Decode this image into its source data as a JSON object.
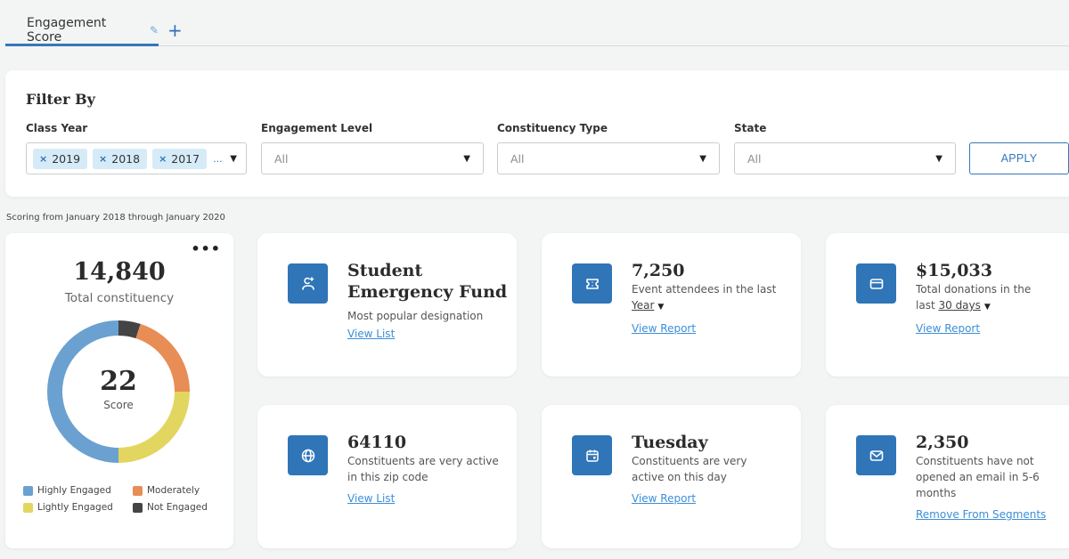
{
  "tabs": {
    "active_label": "Engagement Score",
    "edit_icon": "pencil-icon",
    "add_icon": "plus-icon",
    "add_label": "+"
  },
  "filter": {
    "title": "Filter By",
    "class_year": {
      "label": "Class Year",
      "chips": [
        "2019",
        "2018",
        "2017"
      ],
      "overflow": "...",
      "remove_glyph": "×"
    },
    "engagement_level": {
      "label": "Engagement Level",
      "value": "All"
    },
    "constituency_type": {
      "label": "Constituency Type",
      "value": "All"
    },
    "state": {
      "label": "State",
      "value": "All"
    },
    "apply_label": "APPLY",
    "caret": "▼"
  },
  "scoring_range": "Scoring from January 2018 through January 2020",
  "score_card": {
    "menu_glyph": "•••",
    "total": "14,840",
    "total_label": "Total constituency",
    "score": "22",
    "score_label": "Score",
    "legend": [
      {
        "label": "Highly Engaged",
        "color": "#6aa1d0"
      },
      {
        "label": "Moderately",
        "color": "#e88d55"
      },
      {
        "label": "Lightly Engaged",
        "color": "#e2d660"
      },
      {
        "label": "Not Engaged",
        "color": "#444444"
      }
    ]
  },
  "chart_data": {
    "type": "pie",
    "variant": "donut",
    "title": "Total constituency",
    "center_value": 22,
    "center_label": "Score",
    "legend_position": "bottom",
    "slices": [
      {
        "label": "Not Engaged",
        "value": 5,
        "color": "#444444"
      },
      {
        "label": "Moderately",
        "value": 20,
        "color": "#e88d55"
      },
      {
        "label": "Lightly Engaged",
        "value": 25,
        "color": "#e2d660"
      },
      {
        "label": "Highly Engaged",
        "value": 50,
        "color": "#6aa1d0"
      }
    ],
    "unit": "percent (estimated)"
  },
  "cards": [
    {
      "icon": "user-plus-icon",
      "title": "Student Emergency Fund",
      "desc": "Most popular designation",
      "link": "View List"
    },
    {
      "icon": "ticket-icon",
      "title": "7,250",
      "desc": "Event attendees in the last",
      "dropdown": "Year",
      "link": "View Report"
    },
    {
      "icon": "credit-card-icon",
      "title": "$15,033",
      "desc": "Total donations in the",
      "desc_prefix": "last",
      "dropdown": "30 days",
      "link": "View Report"
    },
    {
      "icon": "globe-icon",
      "title": "64110",
      "desc": "Constituents are very active in this zip code",
      "link": "View List"
    },
    {
      "icon": "calendar-icon",
      "title": "Tuesday",
      "desc": "Constituents are very active on this day",
      "link": "View Report"
    },
    {
      "icon": "mail-icon",
      "title": "2,350",
      "desc": "Constituents have not opened an email in 5-6 months",
      "link": "Remove From Segments"
    }
  ],
  "colors": {
    "accent": "#2f75b8",
    "link": "#3c8ed8",
    "chip_bg": "#d6ebf8",
    "page_bg": "#f3f4f4"
  }
}
